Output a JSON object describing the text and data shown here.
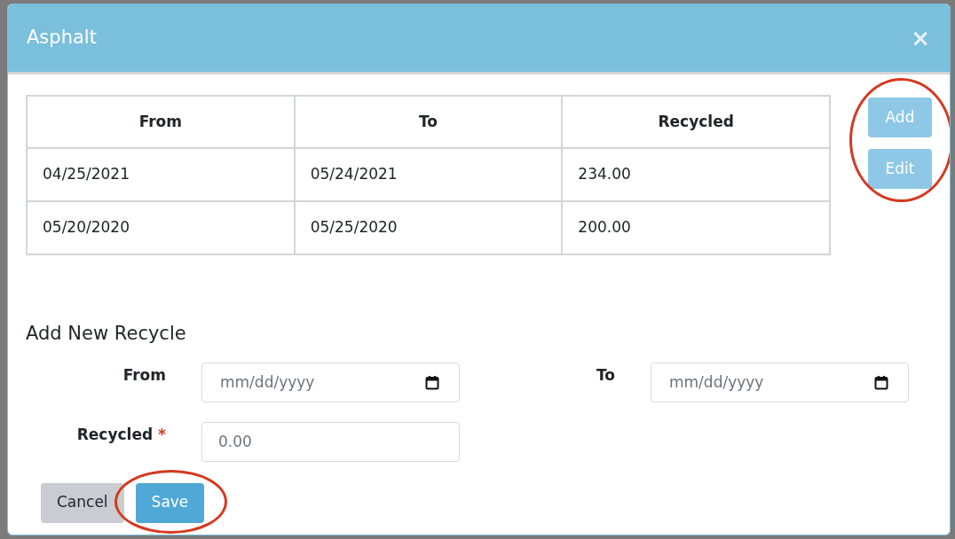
{
  "modal": {
    "title": "Asphalt",
    "close": "×"
  },
  "table": {
    "columns": [
      "From",
      "To",
      "Recycled"
    ],
    "rows": [
      [
        "04/25/2021",
        "05/24/2021",
        "234.00"
      ],
      [
        "05/20/2020",
        "05/25/2020",
        "200.00"
      ]
    ]
  },
  "side_buttons": {
    "circled": true,
    "items": [
      "Add",
      "Edit"
    ]
  },
  "form": {
    "heading": "Add New Recycle",
    "from": {
      "label": "From",
      "placeholder": "mm/dd/yyyy"
    },
    "to": {
      "label": "To",
      "placeholder": "mm/dd/yyyy"
    },
    "recycled": {
      "label": "Recycled",
      "required": true,
      "required_mark": "*",
      "placeholder": "0.00"
    }
  },
  "footer_buttons": [
    {
      "label": "Cancel",
      "kind": "secondary",
      "circled": false
    },
    {
      "label": "Save",
      "kind": "primary",
      "circled": true
    }
  ]
}
